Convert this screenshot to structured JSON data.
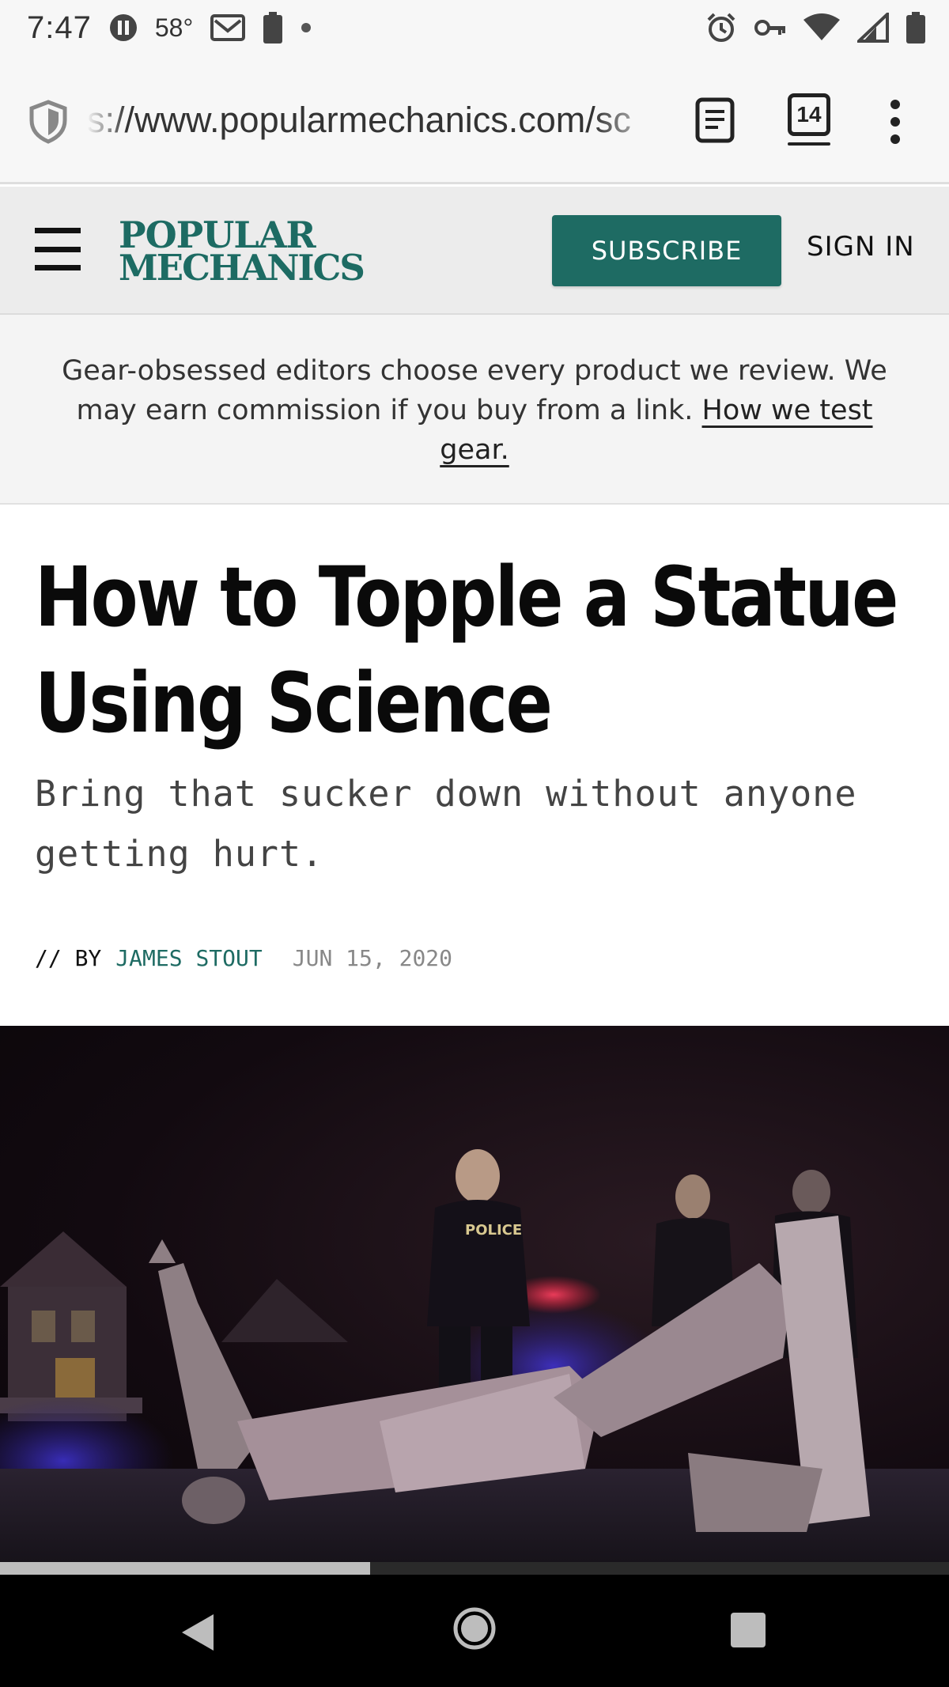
{
  "status_bar": {
    "time": "7:47",
    "temperature": "58°",
    "icons_left": [
      "pause-icon",
      "gmail-icon",
      "battery-saver-icon",
      "notification-dot-icon"
    ],
    "icons_right": [
      "alarm-icon",
      "vpn-key-icon",
      "wifi-icon",
      "cell-signal-icon",
      "battery-icon"
    ]
  },
  "browser": {
    "url": "s://www.popularmechanics.com/sc",
    "tab_count": "14",
    "icons": [
      "shield-icon",
      "reader-mode-icon",
      "tabs-icon",
      "more-menu-icon"
    ]
  },
  "site_header": {
    "logo_line1": "POPULAR",
    "logo_line2": "MECHANICS",
    "subscribe_label": "SUBSCRIBE",
    "signin_label": "SIGN IN",
    "brand_color": "#1e6b63"
  },
  "disclosure": {
    "text": "Gear-obsessed editors choose every product we review. We may earn commission if you buy from a link. ",
    "link_text": "How we test gear."
  },
  "article": {
    "headline": "How to Topple a Statue Using Science",
    "dek": "Bring that sucker down without anyone getting hurt.",
    "byline_prefix": "// BY",
    "author": "JAMES STOUT",
    "date": "JUN 15, 2020"
  },
  "hero": {
    "description_icon": "photo-image",
    "police_label": "POLICE"
  },
  "reading_progress": 0.39,
  "nav_bar": {
    "icons": [
      "back-icon",
      "home-icon",
      "recents-icon"
    ]
  }
}
